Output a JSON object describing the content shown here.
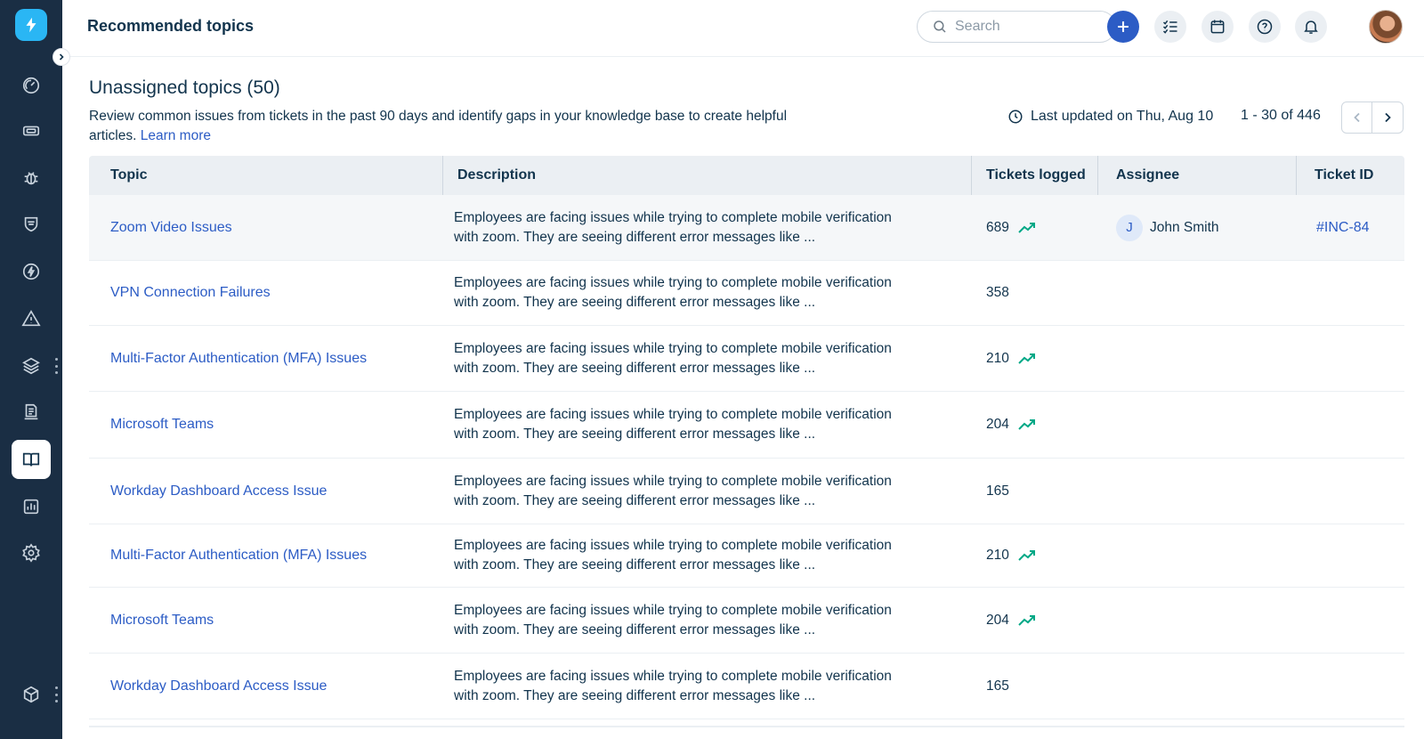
{
  "header": {
    "page_title": "Recommended topics",
    "search_placeholder": "Search"
  },
  "section": {
    "title": "Unassigned topics (50)",
    "description": "Review common issues from tickets in the past 90 days and identify gaps in your knowledge base to create helpful articles.",
    "learn_more": "Learn more",
    "last_updated": "Last updated on Thu, Aug 10",
    "page_range": "1 - 30 of 446"
  },
  "table": {
    "columns": [
      "Topic",
      "Description",
      "Tickets logged",
      "Assignee",
      "Ticket ID"
    ],
    "rows": [
      {
        "topic": "Zoom Video Issues",
        "desc1": "Employees are facing issues while trying to complete mobile verification",
        "desc2": "with zoom. They are seeing different error messages like ...",
        "tickets": "689",
        "trend": true,
        "assignee_initial": "J",
        "assignee": "John Smith",
        "ticket_id": "#INC-84"
      },
      {
        "topic": "VPN Connection Failures",
        "desc1": "Employees are facing issues while trying to complete mobile verification",
        "desc2": "with zoom. They are seeing different error messages like ...",
        "tickets": "358",
        "trend": false,
        "assignee_initial": "",
        "assignee": "",
        "ticket_id": ""
      },
      {
        "topic": "Multi-Factor Authentication (MFA) Issues",
        "desc1": "Employees are facing issues while trying to complete mobile verification",
        "desc2": "with zoom. They are seeing different error messages like ...",
        "tickets": "210",
        "trend": true,
        "assignee_initial": "",
        "assignee": "",
        "ticket_id": ""
      },
      {
        "topic": "Microsoft Teams",
        "desc1": "Employees are facing issues while trying to complete mobile verification",
        "desc2": "with zoom. They are seeing different error messages like ...",
        "tickets": "204",
        "trend": true,
        "assignee_initial": "",
        "assignee": "",
        "ticket_id": ""
      },
      {
        "topic": "Workday Dashboard Access Issue",
        "desc1": "Employees are facing issues while trying to complete mobile verification",
        "desc2": "with zoom. They are seeing different error messages like ...",
        "tickets": "165",
        "trend": false,
        "assignee_initial": "",
        "assignee": "",
        "ticket_id": ""
      },
      {
        "topic": "Multi-Factor Authentication (MFA) Issues",
        "desc1": "Employees are facing issues while trying to complete mobile verification",
        "desc2": "with zoom. They are seeing different error messages like ...",
        "tickets": "210",
        "trend": true,
        "assignee_initial": "",
        "assignee": "",
        "ticket_id": ""
      },
      {
        "topic": "Microsoft Teams",
        "desc1": "Employees are facing issues while trying to complete mobile verification",
        "desc2": "with zoom. They are seeing different error messages like ...",
        "tickets": "204",
        "trend": true,
        "assignee_initial": "",
        "assignee": "",
        "ticket_id": ""
      },
      {
        "topic": "Workday Dashboard Access Issue",
        "desc1": "Employees are facing issues while trying to complete mobile verification",
        "desc2": "with zoom. They are seeing different error messages like ...",
        "tickets": "165",
        "trend": false,
        "assignee_initial": "",
        "assignee": "",
        "ticket_id": ""
      }
    ]
  },
  "sidebar": {
    "items": [
      {
        "name": "dashboard-icon"
      },
      {
        "name": "tickets-icon"
      },
      {
        "name": "problems-bug-icon"
      },
      {
        "name": "changes-shield-icon"
      },
      {
        "name": "releases-bolt-icon"
      },
      {
        "name": "alerts-warning-icon"
      },
      {
        "name": "assets-layers-icon"
      },
      {
        "name": "contracts-icon"
      },
      {
        "name": "solutions-book-icon",
        "active": true
      },
      {
        "name": "reports-icon"
      },
      {
        "name": "admin-gear-icon"
      }
    ],
    "footer_icon": "apps-cube-icon"
  },
  "colors": {
    "sidebar_bg": "#1a2e44",
    "accent": "#2c5cc5",
    "logo": "#2ab6f4",
    "trend_green": "#00a886"
  }
}
